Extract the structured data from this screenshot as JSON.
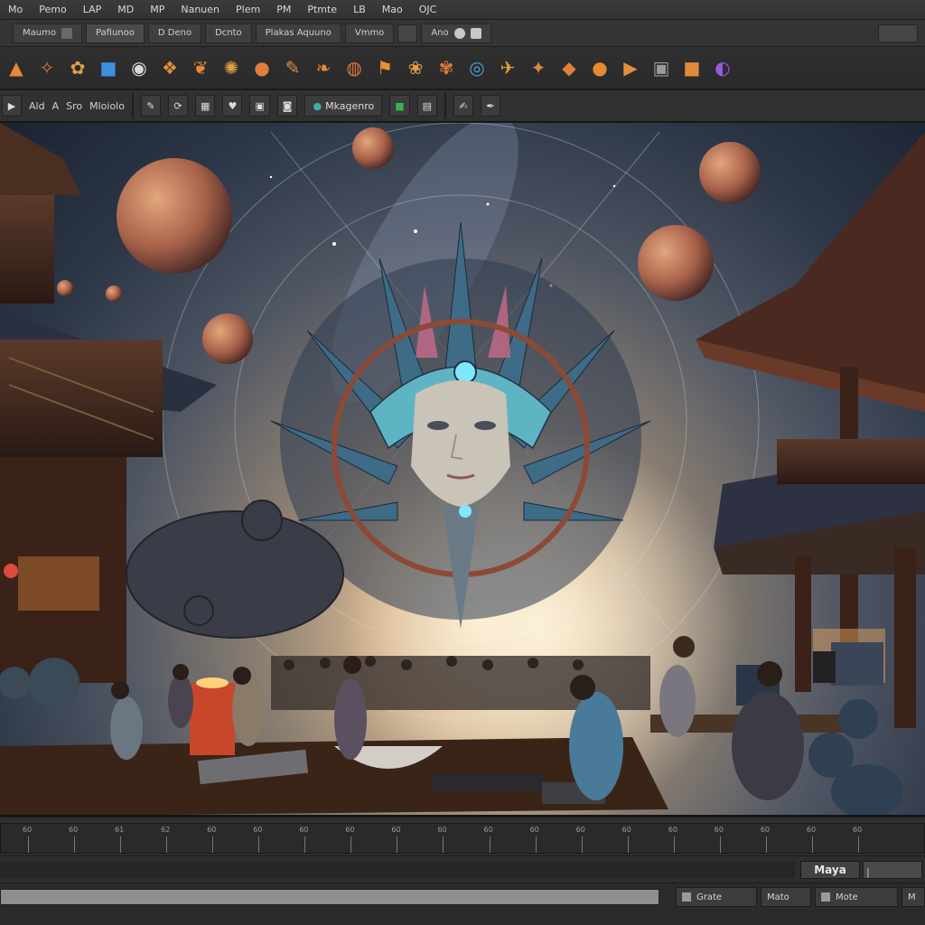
{
  "menu": [
    "Mo",
    "Pemo",
    "LAP",
    "MD",
    "MP",
    "Nanuen",
    "Plem",
    "PM",
    "Ptmte",
    "LB",
    "Mao",
    "OJC"
  ],
  "tabs": [
    {
      "label": "Maumo"
    },
    {
      "label": "Pafiunoo"
    },
    {
      "label": "D Deno"
    },
    {
      "label": "Dcnto"
    },
    {
      "label": "Plakas Aquuno"
    },
    {
      "label": "Vmmo"
    },
    {
      "label": "Ano"
    }
  ],
  "shelf_icons": [
    {
      "name": "cone-icon",
      "glyph": "▲",
      "color": "#e8893a"
    },
    {
      "name": "deform-icon",
      "glyph": "✧",
      "color": "#e07a3c"
    },
    {
      "name": "nodes-icon",
      "glyph": "✿",
      "color": "#e0a040"
    },
    {
      "name": "cube-icon",
      "glyph": "■",
      "color": "#3d8fe0"
    },
    {
      "name": "sphere-icon",
      "glyph": "◉",
      "color": "#d8d8d8"
    },
    {
      "name": "twist-icon",
      "glyph": "❖",
      "color": "#e0903a"
    },
    {
      "name": "bird-icon",
      "glyph": "❦",
      "color": "#e88a30"
    },
    {
      "name": "crab-icon",
      "glyph": "✺",
      "color": "#e0a040"
    },
    {
      "name": "ring-icon",
      "glyph": "●",
      "color": "#e0803a"
    },
    {
      "name": "feather-icon",
      "glyph": "✎",
      "color": "#e09040"
    },
    {
      "name": "leaf-icon",
      "glyph": "❧",
      "color": "#e88a30"
    },
    {
      "name": "circle-icon",
      "glyph": "◍",
      "color": "#e07a3c"
    },
    {
      "name": "flag-icon",
      "glyph": "⚑",
      "color": "#e89030"
    },
    {
      "name": "flower-icon",
      "glyph": "❀",
      "color": "#e0a040"
    },
    {
      "name": "cluster-icon",
      "glyph": "✾",
      "color": "#e07a3c"
    },
    {
      "name": "globe-icon",
      "glyph": "◎",
      "color": "#4ea0d0"
    },
    {
      "name": "wing-icon",
      "glyph": "✈",
      "color": "#e8a030"
    },
    {
      "name": "star-icon",
      "glyph": "✦",
      "color": "#e08a3a"
    },
    {
      "name": "blade-icon",
      "glyph": "◆",
      "color": "#e0803a"
    },
    {
      "name": "orb-icon",
      "glyph": "●",
      "color": "#e88a30"
    },
    {
      "name": "play-icon",
      "glyph": "▶",
      "color": "#e0903a"
    },
    {
      "name": "panel-icon",
      "glyph": "▣",
      "color": "#9a9a9a"
    },
    {
      "name": "block-icon",
      "glyph": "■",
      "color": "#e08a3a"
    },
    {
      "name": "moon-icon",
      "glyph": "◐",
      "color": "#9a5ae0"
    }
  ],
  "toolbar": {
    "label_a": "Ald",
    "label_b": "A",
    "label_c": "Sro",
    "label_d": "Mloiolo",
    "label_e": "Mkagenro"
  },
  "timeline": {
    "ticks": [
      "60",
      "60",
      "61",
      "62",
      "60",
      "60",
      "60",
      "60",
      "60",
      "60",
      "60",
      "60",
      "60",
      "60",
      "60",
      "60",
      "60",
      "60",
      "60"
    ]
  },
  "range": {
    "value": "Maya"
  },
  "status": {
    "field_1": "Grate",
    "field_2": "Mato",
    "field_3": "Mote",
    "field_4": "M"
  },
  "colors": {
    "accent": "#e8893a",
    "panel": "#2a2a2b",
    "viewport_glow": "#f4e3c4"
  }
}
